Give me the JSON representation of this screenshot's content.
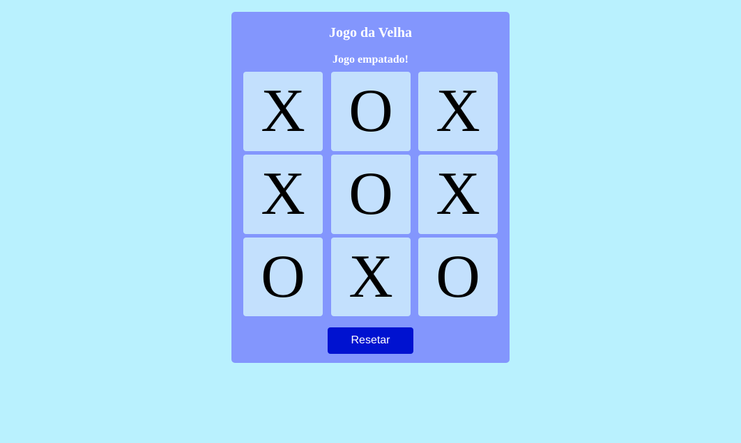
{
  "game": {
    "title": "Jogo da Velha",
    "status": "Jogo empatado!",
    "board": [
      "X",
      "O",
      "X",
      "X",
      "O",
      "X",
      "O",
      "X",
      "O"
    ],
    "reset_label": "Resetar"
  },
  "colors": {
    "background": "#b9f1fe",
    "panel": "#8396fd",
    "cell": "#c3e0fd",
    "button": "#0012d0",
    "text": "#ffffff",
    "mark": "#000000"
  }
}
